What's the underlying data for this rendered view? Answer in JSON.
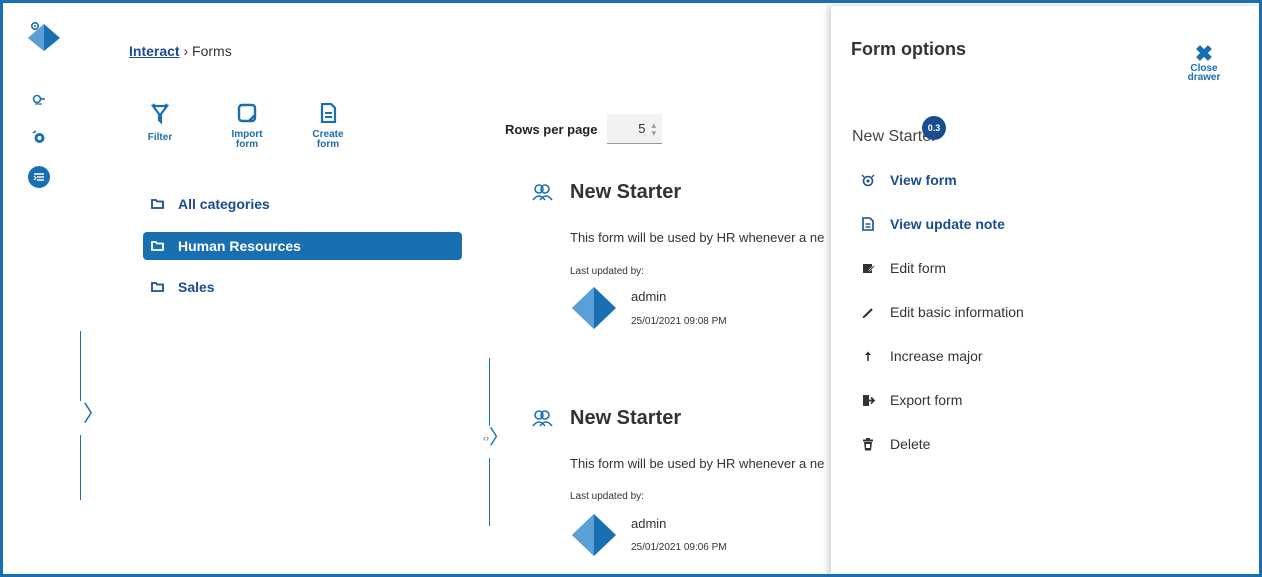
{
  "breadcrumb": {
    "root": "Interact",
    "separator": "›",
    "current": "Forms"
  },
  "toolbar": {
    "filter": "Filter",
    "import": "Import form",
    "create": "Create form"
  },
  "categories": [
    "All categories",
    "Human Resources",
    "Sales"
  ],
  "selected_category": "Human Resources",
  "pagination": {
    "rows_label": "Rows per page",
    "rows_value": "5"
  },
  "forms": [
    {
      "title": "New Starter",
      "description": "This form will be used by HR whenever a ne",
      "updated_label": "Last updated by:",
      "user": "admin",
      "date": "25/01/2021 09:08 PM"
    },
    {
      "title": "New Starter",
      "description": "This form will be used by HR whenever a ne",
      "updated_label": "Last updated by:",
      "user": "admin",
      "date": "25/01/2021 09:06 PM"
    }
  ],
  "drawer": {
    "title": "Form options",
    "close_label_1": "Close",
    "close_label_2": "drawer",
    "form_name": "New Starter",
    "version": "0.3",
    "options": [
      {
        "label": "View form",
        "icon": "eye-icon",
        "primary": true
      },
      {
        "label": "View update note",
        "icon": "document-icon",
        "primary": true
      },
      {
        "label": "Edit form",
        "icon": "edit-form-icon",
        "primary": false
      },
      {
        "label": "Edit basic information",
        "icon": "pencil-icon",
        "primary": false
      },
      {
        "label": "Increase major",
        "icon": "arrow-up-icon",
        "primary": false
      },
      {
        "label": "Export form",
        "icon": "export-icon",
        "primary": false
      },
      {
        "label": "Delete",
        "icon": "trash-icon",
        "primary": false
      }
    ]
  },
  "colors": {
    "accent": "#1a6fb0",
    "dark_accent": "#1a4d8f",
    "selected_bg": "#1a6fb0"
  }
}
